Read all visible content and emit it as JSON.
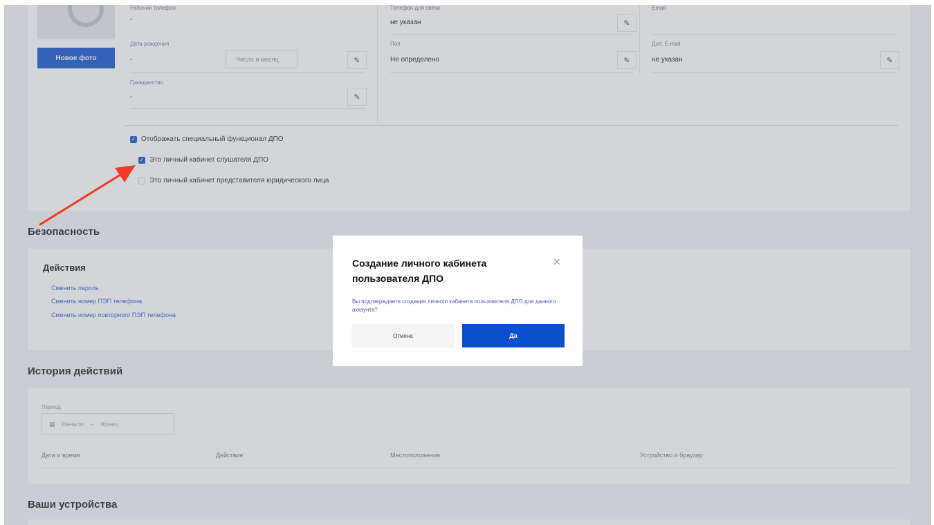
{
  "profile": {
    "photo_button": "Новое фото",
    "fields": {
      "work_phone_label": "Рабочий телефон",
      "work_phone_value": "-",
      "contact_phone_label": "Телефон для связи",
      "contact_phone_value": "не указан",
      "email_label": "Email",
      "birth_date_label": "Дата рождения",
      "birth_date_value": "-",
      "birth_date_select": "Число и месяц",
      "gender_label": "Пол",
      "gender_value": "Не определено",
      "extra_email_label": "Доп. E-mail",
      "extra_email_value": "не указан",
      "citizenship_label": "Гражданство",
      "citizenship_value": "-"
    },
    "checkboxes": [
      {
        "label": "Отображать специальный функционал ДПО",
        "checked": true
      },
      {
        "label": "Это личный кабинет слушателя ДПО",
        "checked": true
      },
      {
        "label": "Это личный кабинет представителя юридического лица",
        "checked": false
      }
    ]
  },
  "security": {
    "title": "Безопасность",
    "actions_title": "Действия",
    "links": [
      "Сменить пароль",
      "Сменить номер ПЭП телефона",
      "Сменить номер повторного ПЭП телефона"
    ]
  },
  "history": {
    "title": "История действий",
    "period_label": "Период",
    "period_start": "Начало",
    "period_sep": "–",
    "period_end": "Конец",
    "columns": [
      "Дата и время",
      "Действие",
      "Местоположение",
      "Устройство и браузер"
    ]
  },
  "devices": {
    "title": "Ваши устройства"
  },
  "modal": {
    "title": "Создание личного кабинета пользователя ДПО",
    "text": "Вы подтверждаете создание личного кабинета пользователя ДПО для данного аккаунта?",
    "cancel": "Отмена",
    "confirm": "Да"
  },
  "colors": {
    "accent": "#0b4fcc",
    "arrow": "#f03a22"
  }
}
